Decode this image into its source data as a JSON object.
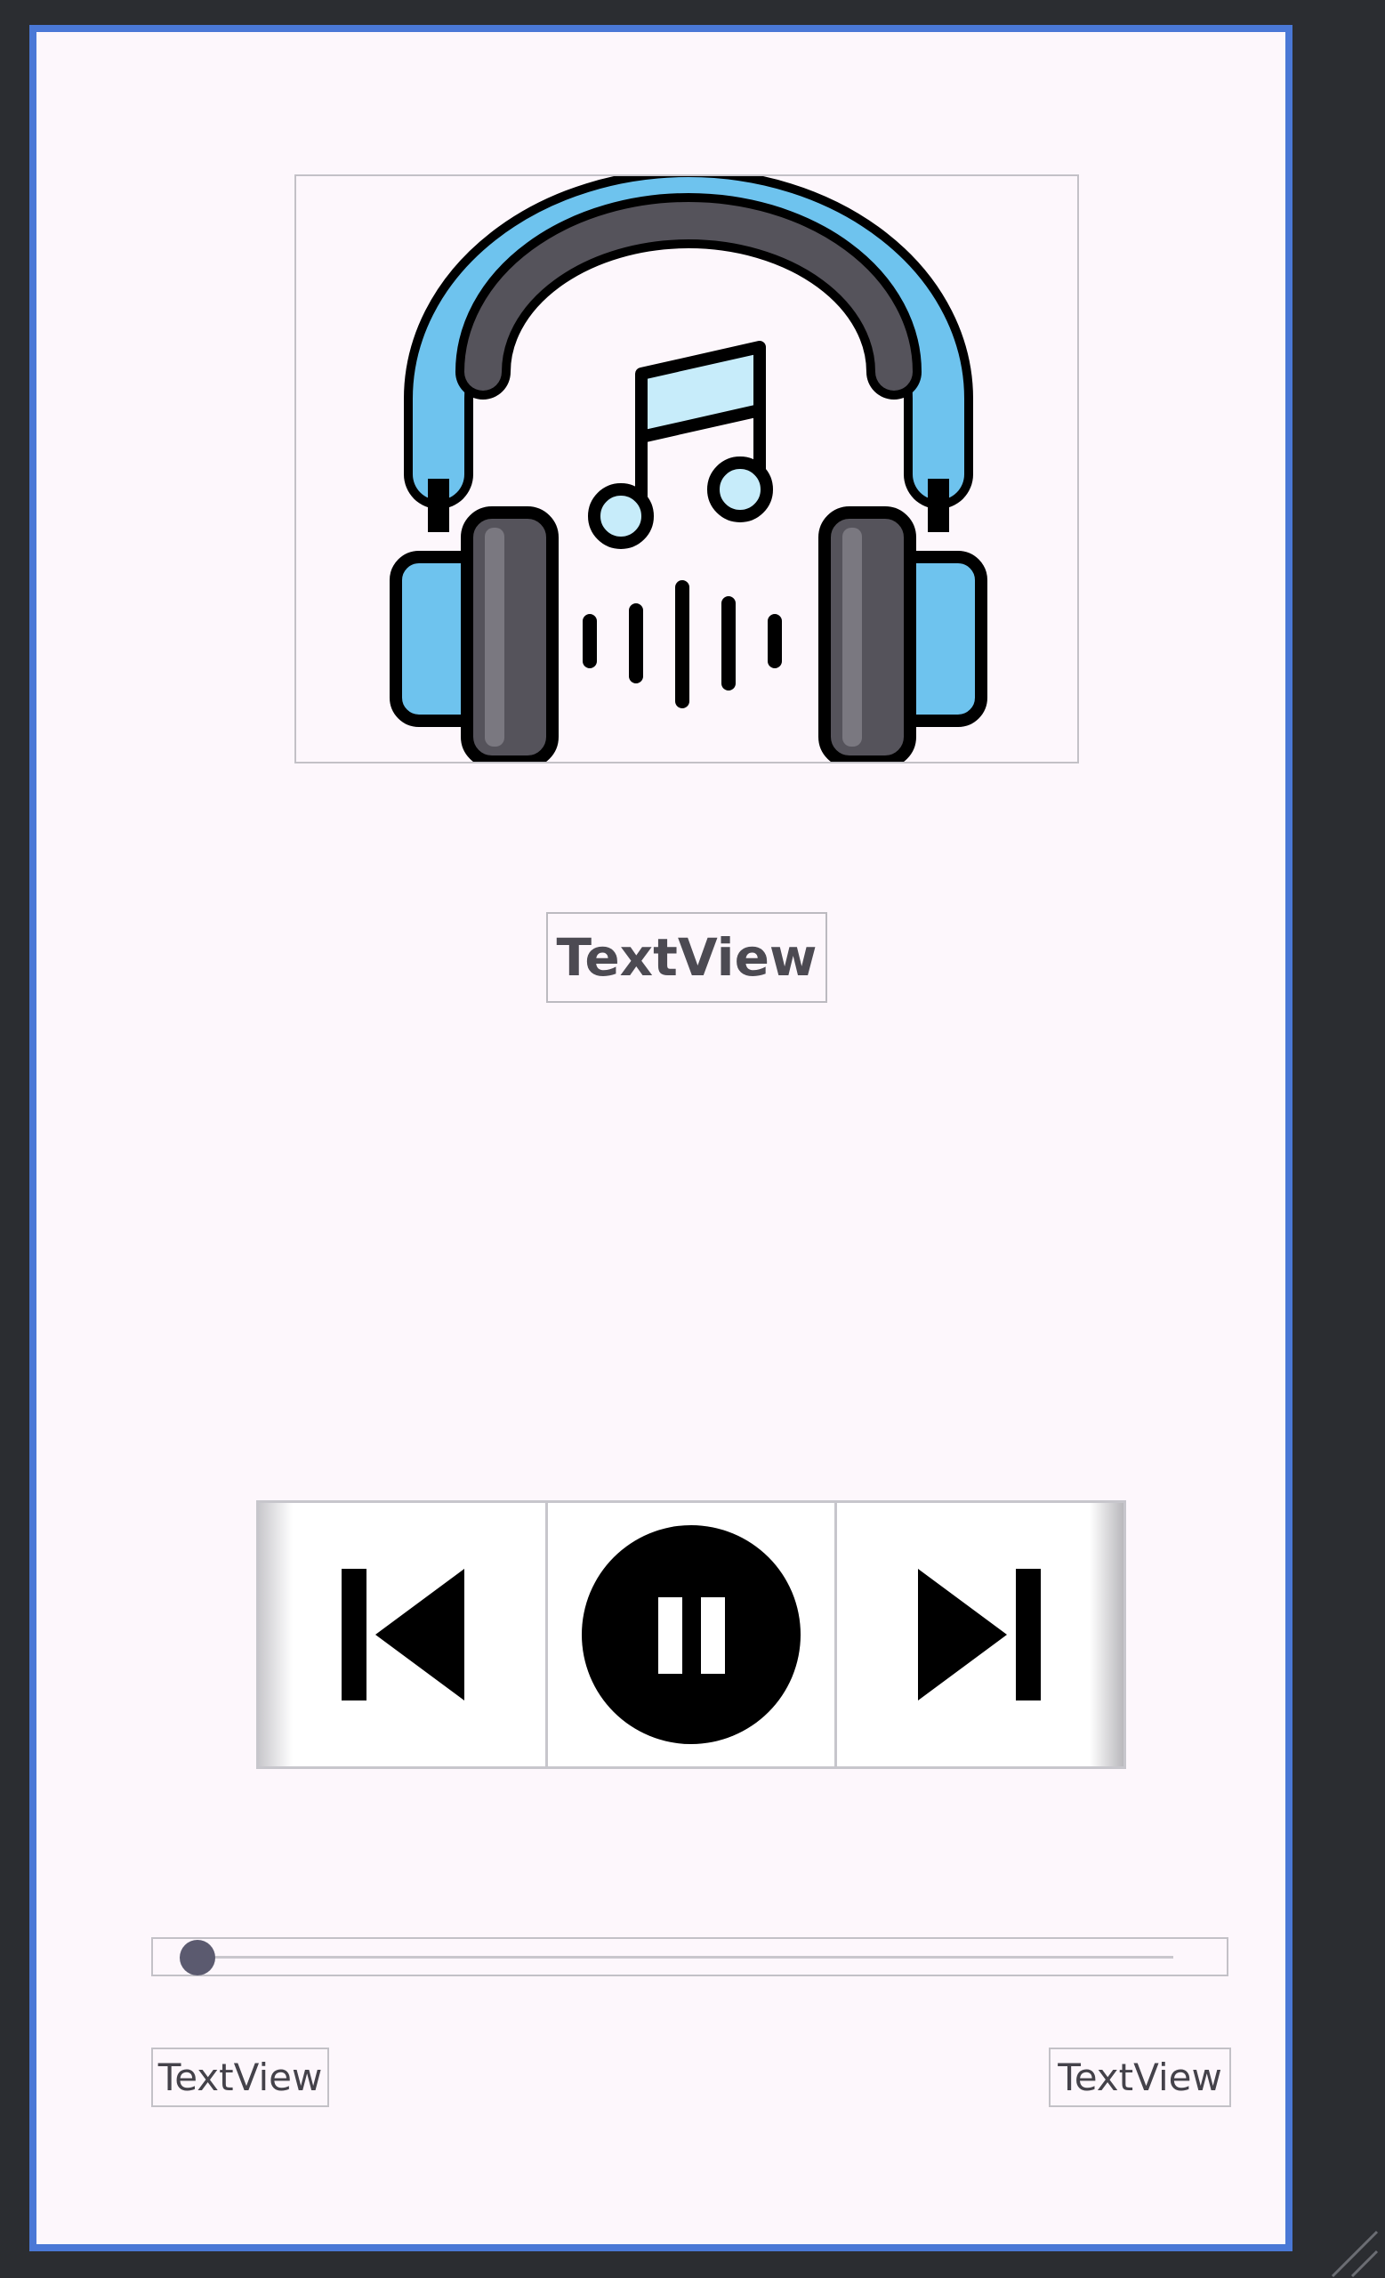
{
  "screen": {
    "frame_color": "#4a78d6",
    "background_color": "#fdf7fc",
    "outer_background": "#2b2d31"
  },
  "album_art": {
    "icon": "headphones-music-icon",
    "colors": {
      "band": "#6ec3ee",
      "dark": "#55535b",
      "note": "#c7ecfa",
      "outline": "#000000"
    }
  },
  "song_title": {
    "text": "TextView"
  },
  "controls": {
    "previous_icon": "skip-previous-icon",
    "play_pause_icon": "pause-circle-icon",
    "next_icon": "skip-next-icon"
  },
  "seekbar": {
    "progress": 0.0,
    "thumb_color": "#5b5a6f"
  },
  "time": {
    "current": "TextView",
    "total": "TextView"
  }
}
